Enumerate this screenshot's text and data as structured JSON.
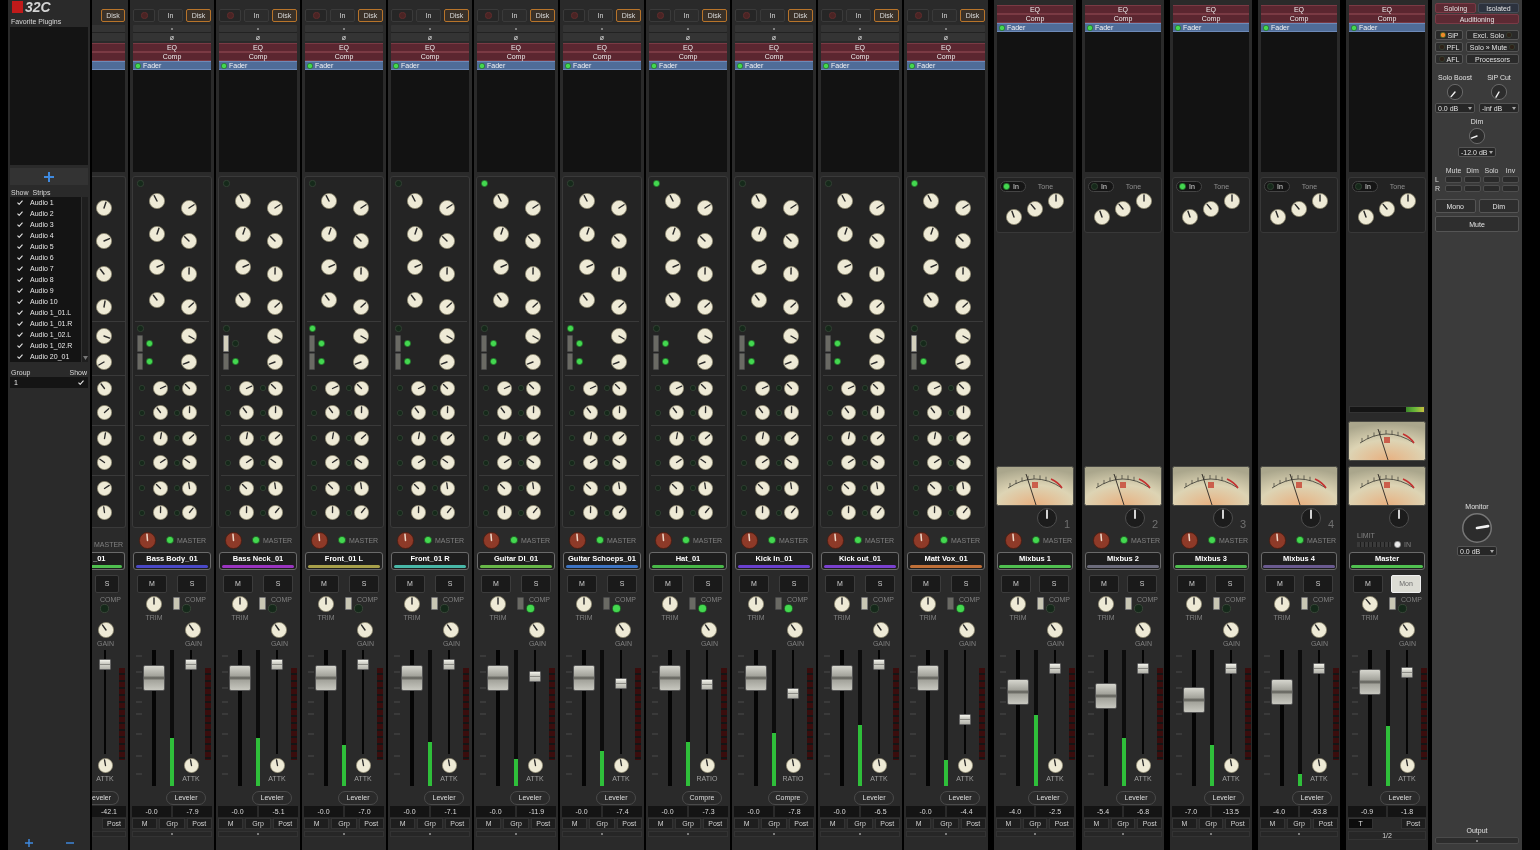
{
  "sidebar": {
    "logo": "32C",
    "favorites_title": "Favorite Plugins",
    "strips_header": [
      "Show",
      "Strips"
    ],
    "strips": [
      {
        "name": "Audio 1",
        "shown": true
      },
      {
        "name": "Audio 2",
        "shown": true
      },
      {
        "name": "Audio 3",
        "shown": true
      },
      {
        "name": "Audio 4",
        "shown": true
      },
      {
        "name": "Audio 5",
        "shown": true
      },
      {
        "name": "Audio 6",
        "shown": true
      },
      {
        "name": "Audio 7",
        "shown": true
      },
      {
        "name": "Audio 8",
        "shown": true
      },
      {
        "name": "Audio 9",
        "shown": true
      },
      {
        "name": "Audio 10",
        "shown": true
      },
      {
        "name": "Audio 1_01.L",
        "shown": true
      },
      {
        "name": "Audio 1_01.R",
        "shown": true
      },
      {
        "name": "Audio 1_02.L",
        "shown": true
      },
      {
        "name": "Audio 1_02.R",
        "shown": true
      },
      {
        "name": "Audio 20_01",
        "shown": true
      }
    ],
    "groups_header": [
      "Group",
      "Show"
    ],
    "groups": [
      {
        "name": "1",
        "shown": true
      }
    ]
  },
  "partial_strip": {
    "input_buttons": [
      {
        "label": "Disk",
        "selected": true
      }
    ],
    "processors": [
      {
        "kind": "plugin"
      },
      {
        "kind": "plugin"
      },
      {
        "kind": "fader"
      }
    ],
    "master_label": "MASTER",
    "name": "_01",
    "color": "#4fbf4f",
    "solo": "S",
    "comp_label": "COMP",
    "comp_on": false,
    "gain_label": "GAIN",
    "comp_fader": {
      "level": 0.9
    },
    "comp_knob_label": "ATTK",
    "comp_mode": "eveler",
    "readouts": [
      "-42.1"
    ],
    "bottom_buttons": [
      "Post"
    ]
  },
  "channels": [
    {
      "input_buttons": [
        {
          "label": "In",
          "selected": false
        },
        {
          "label": "Disk",
          "selected": true
        }
      ],
      "phase": "ø",
      "processors": [
        {
          "kind": "plugin",
          "label": "EQ"
        },
        {
          "kind": "plugin",
          "label": "Comp"
        },
        {
          "kind": "fader",
          "label": "Fader",
          "on": true
        }
      ],
      "eq_on": false,
      "filter_on": false,
      "filters": [
        {
          "on": true
        },
        {
          "on": true
        }
      ],
      "master_assign": {
        "label": "MASTER",
        "on": true
      },
      "name": "Bass Body_01",
      "color": "#4a48c8",
      "mute": "M",
      "solo": "S",
      "trim_label": "TRIM",
      "comp_label": "COMP",
      "comp_on": false,
      "gain_label": "GAIN",
      "fader": {
        "level": 0.86
      },
      "meter": {
        "level": 0.35
      },
      "comp_fader": {
        "level": 0.9
      },
      "comp_knob_label": "ATTK",
      "comp_mode": "Leveler",
      "readouts": [
        "-0.0",
        "-7.9"
      ],
      "bottom_buttons": [
        "M",
        "Grp",
        "Post"
      ]
    },
    {
      "input_buttons": [
        {
          "label": "In",
          "selected": false
        },
        {
          "label": "Disk",
          "selected": true
        }
      ],
      "phase": "ø",
      "processors": [
        {
          "kind": "plugin",
          "label": "EQ"
        },
        {
          "kind": "plugin",
          "label": "Comp"
        },
        {
          "kind": "fader",
          "label": "Fader",
          "on": true
        }
      ],
      "eq_on": false,
      "filter_on": false,
      "filters": [
        {
          "on": false
        },
        {
          "on": true
        }
      ],
      "master_assign": {
        "label": "MASTER",
        "on": true
      },
      "name": "Bass Neck_01",
      "color": "#9a34c0",
      "mute": "M",
      "solo": "S",
      "trim_label": "TRIM",
      "comp_label": "COMP",
      "comp_on": false,
      "gain_label": "GAIN",
      "fader": {
        "level": 0.86
      },
      "meter": {
        "level": 0.35
      },
      "comp_fader": {
        "level": 0.9
      },
      "comp_knob_label": "ATTK",
      "comp_mode": "Leveler",
      "readouts": [
        "-0.0",
        "-5.1"
      ],
      "bottom_buttons": [
        "M",
        "Grp",
        "Post"
      ]
    },
    {
      "input_buttons": [
        {
          "label": "In",
          "selected": false
        },
        {
          "label": "Disk",
          "selected": true
        }
      ],
      "phase": "ø",
      "processors": [
        {
          "kind": "plugin",
          "label": "EQ"
        },
        {
          "kind": "plugin",
          "label": "Comp"
        },
        {
          "kind": "fader",
          "label": "Fader",
          "on": true
        }
      ],
      "eq_on": false,
      "filter_on": true,
      "filters": [
        {
          "on": true
        },
        {
          "on": true
        }
      ],
      "master_assign": {
        "label": "MASTER",
        "on": true
      },
      "name": "Front_01 L",
      "color": "#a8a04a",
      "mute": "M",
      "solo": "S",
      "trim_label": "TRIM",
      "comp_label": "COMP",
      "comp_on": false,
      "gain_label": "GAIN",
      "fader": {
        "level": 0.86
      },
      "meter": {
        "level": 0.3
      },
      "comp_fader": {
        "level": 0.9
      },
      "comp_knob_label": "ATTK",
      "comp_mode": "Leveler",
      "readouts": [
        "-0.0",
        "-7.0"
      ],
      "bottom_buttons": [
        "M",
        "Grp",
        "Post"
      ]
    },
    {
      "input_buttons": [
        {
          "label": "In",
          "selected": false
        },
        {
          "label": "Disk",
          "selected": true
        }
      ],
      "phase": "ø",
      "processors": [
        {
          "kind": "plugin",
          "label": "EQ"
        },
        {
          "kind": "plugin",
          "label": "Comp"
        },
        {
          "kind": "fader",
          "label": "Fader",
          "on": true
        }
      ],
      "eq_on": false,
      "filter_on": false,
      "filters": [
        {
          "on": true
        },
        {
          "on": true
        }
      ],
      "master_assign": {
        "label": "MASTER",
        "on": true
      },
      "name": "Front_01 R",
      "color": "#48b8a8",
      "mute": "M",
      "solo": "S",
      "trim_label": "TRIM",
      "comp_label": "COMP",
      "comp_on": false,
      "gain_label": "GAIN",
      "fader": {
        "level": 0.86
      },
      "meter": {
        "level": 0.32
      },
      "comp_fader": {
        "level": 0.9
      },
      "comp_knob_label": "ATTK",
      "comp_mode": "Leveler",
      "readouts": [
        "-0.0",
        "-7.1"
      ],
      "bottom_buttons": [
        "M",
        "Grp",
        "Post"
      ]
    },
    {
      "input_buttons": [
        {
          "label": "In",
          "selected": false
        },
        {
          "label": "Disk",
          "selected": true
        }
      ],
      "phase": "ø",
      "processors": [
        {
          "kind": "plugin",
          "label": "EQ"
        },
        {
          "kind": "plugin",
          "label": "Comp"
        },
        {
          "kind": "fader",
          "label": "Fader",
          "on": true
        }
      ],
      "eq_on": true,
      "filter_on": false,
      "filters": [
        {
          "on": true
        },
        {
          "on": true
        }
      ],
      "master_assign": {
        "label": "MASTER",
        "on": true
      },
      "name": "Guitar DI_01",
      "color": "#68b848",
      "mute": "M",
      "solo": "S",
      "trim_label": "TRIM",
      "comp_label": "COMP",
      "comp_on": true,
      "gain_label": "GAIN",
      "fader": {
        "level": 0.86
      },
      "meter": {
        "level": 0.2
      },
      "comp_fader": {
        "level": 0.77
      },
      "comp_knob_label": "ATTK",
      "comp_mode": "Leveler",
      "readouts": [
        "-0.0",
        "-11.9"
      ],
      "bottom_buttons": [
        "M",
        "Grp",
        "Post"
      ]
    },
    {
      "input_buttons": [
        {
          "label": "In",
          "selected": false
        },
        {
          "label": "Disk",
          "selected": true
        }
      ],
      "phase": "ø",
      "processors": [
        {
          "kind": "plugin",
          "label": "EQ"
        },
        {
          "kind": "plugin",
          "label": "Comp"
        },
        {
          "kind": "fader",
          "label": "Fader",
          "on": true
        }
      ],
      "eq_on": false,
      "filter_on": true,
      "filters": [
        {
          "on": true
        },
        {
          "on": true
        }
      ],
      "master_assign": {
        "label": "MASTER",
        "on": true
      },
      "name": "Guitar Schoeps_01",
      "color": "#3c74c4",
      "mute": "M",
      "solo": "S",
      "trim_label": "TRIM",
      "comp_label": "COMP",
      "comp_on": true,
      "gain_label": "GAIN",
      "fader": {
        "level": 0.86
      },
      "meter": {
        "level": 0.26
      },
      "comp_fader": {
        "level": 0.7
      },
      "comp_knob_label": "ATTK",
      "comp_mode": "Leveler",
      "readouts": [
        "-0.0",
        "-7.4"
      ],
      "bottom_buttons": [
        "M",
        "Grp",
        "Post"
      ]
    },
    {
      "input_buttons": [
        {
          "label": "In",
          "selected": false
        },
        {
          "label": "Disk",
          "selected": true
        }
      ],
      "phase": "ø",
      "processors": [
        {
          "kind": "plugin",
          "label": "EQ"
        },
        {
          "kind": "plugin",
          "label": "Comp"
        },
        {
          "kind": "fader",
          "label": "Fader",
          "on": true
        }
      ],
      "eq_on": true,
      "filter_on": false,
      "filters": [
        {
          "on": true
        },
        {
          "on": true
        }
      ],
      "master_assign": {
        "label": "MASTER",
        "on": true
      },
      "name": "Hat_01",
      "color": "#48b848",
      "mute": "M",
      "solo": "S",
      "trim_label": "TRIM",
      "comp_label": "COMP",
      "comp_on": true,
      "gain_label": "GAIN",
      "fader": {
        "level": 0.86
      },
      "meter": {
        "level": 0.32
      },
      "comp_fader": {
        "level": 0.69
      },
      "comp_knob_label": "RATIO",
      "comp_mode": "Compre",
      "readouts": [
        "-0.0",
        "-7.3"
      ],
      "bottom_buttons": [
        "M",
        "Grp",
        "Post"
      ]
    },
    {
      "input_buttons": [
        {
          "label": "In",
          "selected": false
        },
        {
          "label": "Disk",
          "selected": true
        }
      ],
      "phase": "ø",
      "processors": [
        {
          "kind": "plugin",
          "label": "EQ"
        },
        {
          "kind": "plugin",
          "label": "Comp"
        },
        {
          "kind": "fader",
          "label": "Fader",
          "on": true
        }
      ],
      "eq_on": false,
      "filter_on": false,
      "filters": [
        {
          "on": true
        },
        {
          "on": true
        }
      ],
      "master_assign": {
        "label": "MASTER",
        "on": true
      },
      "name": "Kick In_01",
      "color": "#6a40d0",
      "mute": "M",
      "solo": "S",
      "trim_label": "TRIM",
      "comp_label": "COMP",
      "comp_on": true,
      "gain_label": "GAIN",
      "fader": {
        "level": 0.86
      },
      "meter": {
        "level": 0.39
      },
      "comp_fader": {
        "level": 0.59
      },
      "comp_knob_label": "RATIO",
      "comp_mode": "Compre",
      "readouts": [
        "-0.0",
        "-7.8"
      ],
      "bottom_buttons": [
        "M",
        "Grp",
        "Post"
      ]
    },
    {
      "input_buttons": [
        {
          "label": "In",
          "selected": false
        },
        {
          "label": "Disk",
          "selected": true
        }
      ],
      "phase": "ø",
      "processors": [
        {
          "kind": "plugin",
          "label": "EQ"
        },
        {
          "kind": "plugin",
          "label": "Comp"
        },
        {
          "kind": "fader",
          "label": "Fader",
          "on": true
        }
      ],
      "eq_on": false,
      "filter_on": false,
      "filters": [
        {
          "on": true
        },
        {
          "on": true
        }
      ],
      "master_assign": {
        "label": "MASTER",
        "on": true
      },
      "name": "Kick out_01",
      "color": "#7a40d0",
      "mute": "M",
      "solo": "S",
      "trim_label": "TRIM",
      "comp_label": "COMP",
      "comp_on": false,
      "gain_label": "GAIN",
      "fader": {
        "level": 0.86
      },
      "meter": {
        "level": 0.45
      },
      "comp_fader": {
        "level": 0.9
      },
      "comp_knob_label": "ATTK",
      "comp_mode": "Leveler",
      "readouts": [
        "-0.0",
        "-6.5"
      ],
      "bottom_buttons": [
        "M",
        "Grp",
        "Post"
      ]
    },
    {
      "input_buttons": [
        {
          "label": "In",
          "selected": false
        },
        {
          "label": "Disk",
          "selected": true
        }
      ],
      "phase": "ø",
      "processors": [
        {
          "kind": "plugin",
          "label": "EQ"
        },
        {
          "kind": "plugin",
          "label": "Comp"
        },
        {
          "kind": "fader",
          "label": "Fader",
          "on": true
        }
      ],
      "eq_on": true,
      "filter_on": false,
      "filters": [
        {
          "on": false
        },
        {
          "on": true
        }
      ],
      "master_assign": {
        "label": "MASTER",
        "on": true
      },
      "name": "Matt Vox_01",
      "color": "#c07038",
      "mute": "M",
      "solo": "S",
      "trim_label": "TRIM",
      "comp_label": "COMP",
      "comp_on": true,
      "gain_label": "GAIN",
      "fader": {
        "level": 0.86
      },
      "meter": {
        "level": 0.19
      },
      "comp_fader": {
        "level": 0.31
      },
      "comp_knob_label": "ATTK",
      "comp_mode": "Leveler",
      "readouts": [
        "-0.0",
        "-4.4"
      ],
      "bottom_buttons": [
        "M",
        "Grp",
        "Post"
      ]
    }
  ],
  "mixbuses": [
    {
      "processors": [
        {
          "kind": "plugin",
          "label": "EQ"
        },
        {
          "kind": "plugin",
          "label": "Comp"
        },
        {
          "kind": "fader",
          "label": "Fader",
          "on": true
        }
      ],
      "tone_label": "Tone",
      "tone_in": {
        "label": "In",
        "on": true
      },
      "number": "1",
      "master_assign": {
        "label": "MASTER",
        "on": true
      },
      "name": "Mixbus 1",
      "color": "#50c050",
      "mute": "M",
      "solo": "S",
      "trim_label": "TRIM",
      "comp_label": "COMP",
      "comp_on": false,
      "gain_label": "GAIN",
      "fader": {
        "level": 0.74
      },
      "meter": {
        "level": 0.52
      },
      "comp_fader": {
        "level": 0.86
      },
      "comp_knob_label": "ATTK",
      "comp_mode": "Leveler",
      "readouts": [
        "-4.0",
        "-2.5"
      ],
      "bottom_buttons": [
        "M",
        "Grp",
        "Post"
      ]
    },
    {
      "processors": [
        {
          "kind": "plugin",
          "label": "EQ"
        },
        {
          "kind": "plugin",
          "label": "Comp"
        },
        {
          "kind": "fader",
          "label": "Fader",
          "on": true
        }
      ],
      "tone_label": "Tone",
      "tone_in": {
        "label": "In",
        "on": false
      },
      "number": "2",
      "master_assign": {
        "label": "MASTER",
        "on": true
      },
      "name": "Mixbus 2",
      "color": "#6c6c7c",
      "mute": "M",
      "solo": "S",
      "trim_label": "TRIM",
      "comp_label": "COMP",
      "comp_on": false,
      "gain_label": "GAIN",
      "fader": {
        "level": 0.7
      },
      "meter": {
        "level": 0.35
      },
      "comp_fader": {
        "level": 0.86
      },
      "comp_knob_label": "ATTK",
      "comp_mode": "Leveler",
      "readouts": [
        "-5.4",
        "-6.8"
      ],
      "bottom_buttons": [
        "M",
        "Grp",
        "Post"
      ]
    },
    {
      "processors": [
        {
          "kind": "plugin",
          "label": "EQ"
        },
        {
          "kind": "plugin",
          "label": "Comp"
        },
        {
          "kind": "fader",
          "label": "Fader",
          "on": true
        }
      ],
      "tone_label": "Tone",
      "tone_in": {
        "label": "In",
        "on": true
      },
      "number": "3",
      "master_assign": {
        "label": "MASTER",
        "on": true
      },
      "name": "Mixbus 3",
      "color": "#50c050",
      "mute": "M",
      "solo": "S",
      "trim_label": "TRIM",
      "comp_label": "COMP",
      "comp_on": false,
      "gain_label": "GAIN",
      "fader": {
        "level": 0.66
      },
      "meter": {
        "level": 0.3
      },
      "comp_fader": {
        "level": 0.86
      },
      "comp_knob_label": "ATTK",
      "comp_mode": "Leveler",
      "readouts": [
        "-7.0",
        "-13.5"
      ],
      "bottom_buttons": [
        "M",
        "Grp",
        "Post"
      ]
    },
    {
      "processors": [
        {
          "kind": "plugin",
          "label": "EQ"
        },
        {
          "kind": "plugin",
          "label": "Comp"
        },
        {
          "kind": "fader",
          "label": "Fader",
          "on": true
        }
      ],
      "tone_label": "Tone",
      "tone_in": {
        "label": "In",
        "on": false
      },
      "number": "4",
      "master_assign": {
        "label": "MASTER",
        "on": true
      },
      "name": "Mixbus 4",
      "color": "#6a5a90",
      "mute": "M",
      "solo": "S",
      "trim_label": "TRIM",
      "comp_label": "COMP",
      "comp_on": false,
      "gain_label": "GAIN",
      "fader": {
        "level": 0.74
      },
      "meter": {
        "level": 0.09
      },
      "comp_fader": {
        "level": 0.86
      },
      "comp_knob_label": "ATTK",
      "comp_mode": "Leveler",
      "readouts": [
        "-4.0",
        "-63.8"
      ],
      "bottom_buttons": [
        "M",
        "Grp",
        "Post"
      ]
    }
  ],
  "master": {
    "processors": [
      {
        "kind": "plugin",
        "label": "EQ"
      },
      {
        "kind": "plugin",
        "label": "Comp"
      },
      {
        "kind": "fader",
        "label": "Fader",
        "on": true
      }
    ],
    "tone_label": "Tone",
    "tone_in": {
      "label": "In",
      "on": false
    },
    "limiter": {
      "label": "LIMIT",
      "in_label": "IN",
      "on": true
    },
    "name": "Master",
    "color": "#50c050",
    "mute": "M",
    "monitor_button": {
      "label": "Mon",
      "on": true
    },
    "trim_label": "TRIM",
    "comp_label": "COMP",
    "comp_on": false,
    "gain_label": "GAIN",
    "fader": {
      "level": 0.83
    },
    "meter": {
      "level": 0.44
    },
    "comp_fader": {
      "level": 0.82
    },
    "comp_knob_label": "ATTK",
    "comp_mode": "Leveler",
    "readouts": [
      "-0.9",
      "-1.8"
    ],
    "bottom_buttons": [
      "T",
      "Post"
    ],
    "footer": "1/2"
  },
  "monitor": {
    "solo_modes": [
      {
        "label": "Soloing",
        "selected": true
      },
      {
        "label": "Isolated",
        "selected": false
      }
    ],
    "auditioning": {
      "label": "Auditioning",
      "on": true
    },
    "options": [
      {
        "kind": "left",
        "label": "SiP",
        "on": true
      },
      {
        "kind": "right",
        "label": "Excl. Solo",
        "on": false
      },
      {
        "kind": "left",
        "label": "PFL",
        "on": false
      },
      {
        "kind": "right",
        "label": "Solo » Mute",
        "on": false
      },
      {
        "kind": "left",
        "label": "AFL",
        "on": false
      },
      {
        "kind": "plain",
        "label": "Processors"
      }
    ],
    "solo_boost": {
      "label": "Solo Boost",
      "value": "0.0 dB"
    },
    "sip_cut": {
      "label": "SiP Cut",
      "value": "-inf dB"
    },
    "dim": {
      "label": "Dim",
      "value": "-12.0 dB"
    },
    "matrix": {
      "columns": [
        "Mute",
        "Dim",
        "Solo",
        "Inv"
      ],
      "rows": [
        {
          "label": "L",
          "cells": [
            {
              "on": false
            },
            {
              "on": false
            },
            {
              "on": false
            },
            {
              "on": false
            }
          ]
        },
        {
          "label": "R",
          "cells": [
            {
              "on": false
            },
            {
              "on": false
            },
            {
              "on": false
            },
            {
              "on": false
            }
          ]
        }
      ]
    },
    "buttons": [
      "Mono",
      "Dim"
    ],
    "mute": "Mute",
    "monitor_level": {
      "label": "Monitor",
      "value": "0.0 dB"
    },
    "output_label": "Output"
  }
}
